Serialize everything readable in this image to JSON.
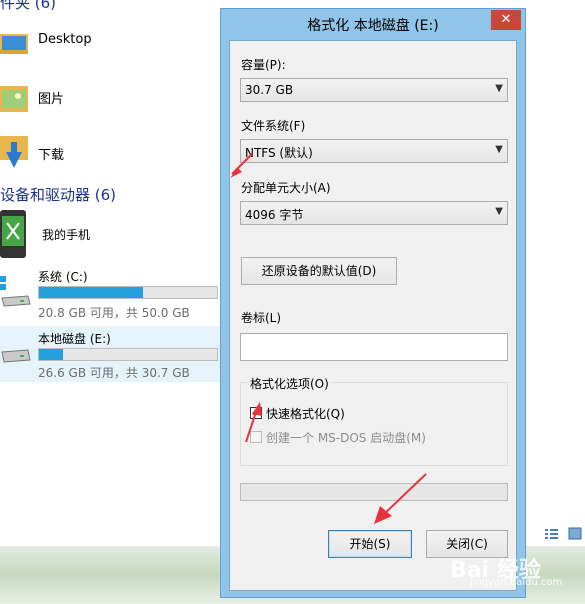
{
  "explorer": {
    "top_section_title": "件夹 (6)",
    "folders": [
      {
        "label": "Desktop",
        "icon": "folder-desktop-icon"
      },
      {
        "label": "图片",
        "icon": "folder-pictures-icon"
      },
      {
        "label": "下载",
        "icon": "folder-downloads-icon"
      }
    ],
    "devices_section_title": "设备和驱动器 (6)",
    "phone": {
      "label": "我的手机",
      "icon": "phone-icon"
    },
    "drives": [
      {
        "name": "系统 (C:)",
        "usage": 0.584,
        "space": "20.8 GB 可用，共 50.0 GB",
        "icon": "windows-drive-icon"
      },
      {
        "name": "本地磁盘 (E:)",
        "usage": 0.134,
        "space": "26.6 GB 可用，共 30.7 GB",
        "icon": "hard-drive-icon"
      }
    ]
  },
  "dialog": {
    "title": "格式化 本地磁盘 (E:)",
    "close_label": "✕",
    "capacity": {
      "label": "容量(P):",
      "value": "30.7 GB"
    },
    "filesystem": {
      "label": "文件系统(F)",
      "value": "NTFS (默认)"
    },
    "allocation": {
      "label": "分配单元大小(A)",
      "value": "4096 字节"
    },
    "restore_defaults_label": "还原设备的默认值(D)",
    "volume_label": {
      "label": "卷标(L)",
      "value": ""
    },
    "format_options": {
      "title": "格式化选项(O)",
      "quick_format": {
        "label": "快速格式化(Q)",
        "checked": true
      },
      "msdos_boot": {
        "label": "创建一个 MS-DOS 启动盘(M)",
        "checked": false,
        "disabled": true
      }
    },
    "progress": 0,
    "start_label": "开始(S)",
    "close_button_label": "关闭(C)"
  },
  "colors": {
    "dialog_frame": "#90c4e8",
    "close_button": "#c7483a",
    "drive_bar": "#26a0da",
    "annotation_arrow": "#e8333a"
  }
}
